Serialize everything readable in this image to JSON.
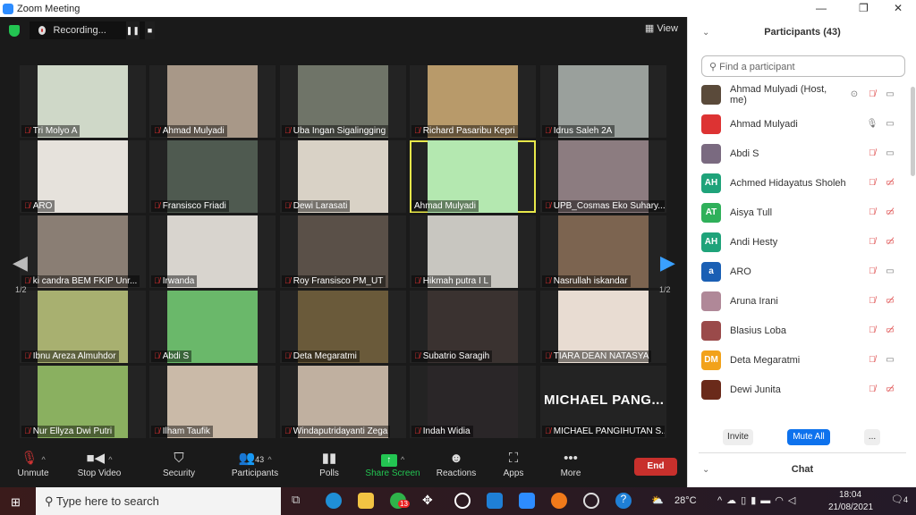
{
  "window": {
    "title": "Zoom Meeting",
    "controls": [
      "—",
      "❐",
      "✕"
    ]
  },
  "topbar": {
    "recording": "Recording...",
    "view": "View"
  },
  "tiles": [
    {
      "name": "Tri Molyo A",
      "muted": true,
      "color": "#cfd8c8"
    },
    {
      "name": "Ahmad Mulyadi",
      "muted": true,
      "color": "#a89888"
    },
    {
      "name": "Uba Ingan Sigalingging",
      "muted": true,
      "color": "#6f7468"
    },
    {
      "name": "Richard Pasaribu Kepri",
      "muted": true,
      "color": "#b89a6a"
    },
    {
      "name": "Idrus Saleh 2A",
      "muted": true,
      "color": "#9aa09c"
    },
    {
      "name": "ARO",
      "muted": true,
      "color": "#e6e2dc"
    },
    {
      "name": "Fransisco Friadi",
      "muted": true,
      "color": "#4f5a50"
    },
    {
      "name": "Dewi Larasati",
      "muted": true,
      "color": "#d9d2c6"
    },
    {
      "name": "Ahmad Mulyadi",
      "muted": false,
      "active": true,
      "color": "#b4e8b0"
    },
    {
      "name": "UPB_Cosmas Eko Suhary...",
      "muted": true,
      "color": "#8c7c80"
    },
    {
      "name": "ki candra BEM FKIP Unr...",
      "muted": true,
      "color": "#8a7e74"
    },
    {
      "name": "Irwanda",
      "muted": true,
      "color": "#d8d4ce"
    },
    {
      "name": "Roy Fransisco PM_UT",
      "muted": true,
      "color": "#5a5048"
    },
    {
      "name": "Hikmah putra I L",
      "muted": true,
      "color": "#c8c6c0"
    },
    {
      "name": "Nasrullah iskandar",
      "muted": true,
      "color": "#7c6450"
    },
    {
      "name": "Ibnu Areza Almuhdor",
      "muted": true,
      "color": "#a8b070"
    },
    {
      "name": "Abdi S",
      "muted": true,
      "color": "#6ab86a"
    },
    {
      "name": "Deta Megaratmi",
      "muted": true,
      "color": "#6a5a3a"
    },
    {
      "name": "Subatrio Saragih",
      "muted": true,
      "color": "#3a3230"
    },
    {
      "name": "TIARA DEAN NATASYA",
      "muted": true,
      "color": "#e8dcd2"
    },
    {
      "name": "Nur Ellyza Dwi Putri",
      "muted": true,
      "color": "#8ab060"
    },
    {
      "name": "Ilham Taufik",
      "muted": true,
      "color": "#cabaa8"
    },
    {
      "name": "Windaputridayanti Zega",
      "muted": true,
      "color": "#c0b0a0"
    },
    {
      "name": "Indah Widia",
      "muted": true,
      "color": "#2a2628"
    },
    {
      "name": "MICHAEL PANGIHUTAN S...",
      "muted": true,
      "big": "MICHAEL  PANG...",
      "color": ""
    }
  ],
  "pager": {
    "left": "1/2",
    "right": "1/2"
  },
  "toolbar": {
    "unmute": "Unmute",
    "stop_video": "Stop Video",
    "security": "Security",
    "participants": "Participants",
    "participants_count": "43",
    "polls": "Polls",
    "share": "Share Screen",
    "reactions": "Reactions",
    "apps": "Apps",
    "more": "More",
    "end": "End"
  },
  "panel": {
    "title": "Participants (43)",
    "search_placeholder": "Find a participant",
    "invite": "Invite",
    "mute_all": "Mute All",
    "more": "...",
    "chat": "Chat",
    "participants": [
      {
        "name": "Ahmad Mulyadi (Host, me)",
        "avatar": "",
        "avcolor": "#5a4a3a",
        "rec": true,
        "mic": "muted",
        "video": "on"
      },
      {
        "name": "Ahmad Mulyadi",
        "avatar": "",
        "avcolor": "#d33",
        "mic": "on",
        "video": "on"
      },
      {
        "name": "Abdi S",
        "avatar": "",
        "avcolor": "#7a6a80",
        "mic": "muted",
        "video": "on"
      },
      {
        "name": "Achmed Hidayatus Sholeh",
        "avatar": "AH",
        "avcolor": "#1fa37a",
        "mic": "muted",
        "video": "off"
      },
      {
        "name": "Aisya Tull",
        "avatar": "AT",
        "avcolor": "#2fb05a",
        "mic": "muted",
        "video": "off"
      },
      {
        "name": "Andi Hesty",
        "avatar": "AH",
        "avcolor": "#1fa37a",
        "mic": "muted",
        "video": "off"
      },
      {
        "name": "ARO",
        "avatar": "a",
        "avcolor": "#1a5fb4",
        "mic": "muted",
        "video": "on"
      },
      {
        "name": "Aruna Irani",
        "avatar": "",
        "avcolor": "#b08898",
        "mic": "muted",
        "video": "off"
      },
      {
        "name": "Blasius Loba",
        "avatar": "",
        "avcolor": "#9a4a4a",
        "mic": "muted",
        "video": "off"
      },
      {
        "name": "Deta Megaratmi",
        "avatar": "DM",
        "avcolor": "#f2a21a",
        "mic": "muted",
        "video": "on"
      },
      {
        "name": "Dewi Junita",
        "avatar": "",
        "avcolor": "#6a2a1a",
        "mic": "muted",
        "video": "off"
      }
    ]
  },
  "taskbar": {
    "search": "Type here to search",
    "whatsapp_badge": "13",
    "weather": "28°C",
    "time": "18:04",
    "date": "21/08/2021",
    "notifications": "4"
  }
}
